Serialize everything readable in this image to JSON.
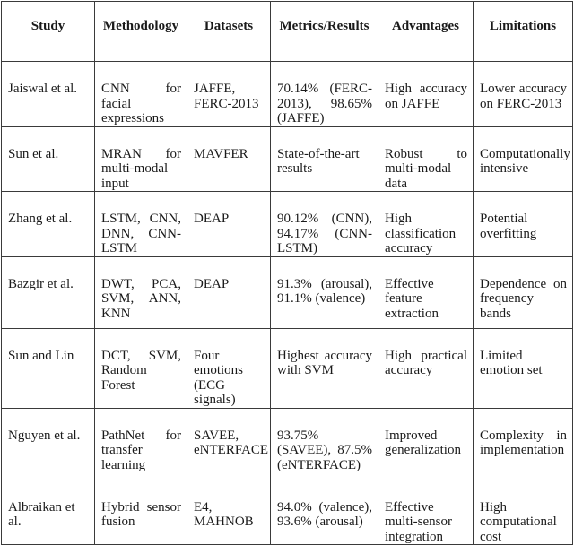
{
  "table": {
    "headers": [
      "Study",
      "Methodology",
      "Datasets",
      "Metrics/Results",
      "Advantages",
      "Limitations"
    ],
    "rows": [
      {
        "study": "Jaiswal et al.",
        "methodology": "CNN for facial expressions",
        "datasets": "JAFFE, FERC-2013",
        "metrics": "70.14% (FERC-2013), 98.65% (JAFFE)",
        "advantages": "High accuracy on JAFFE",
        "limitations": "Lower accuracy on FERC-2013"
      },
      {
        "study": "Sun et al.",
        "methodology": "MRAN for multi-modal input",
        "datasets": "MAVFER",
        "metrics": "State-of-the-art results",
        "advantages": "Robust to multi-modal data",
        "limitations": "Computationally intensive"
      },
      {
        "study": "Zhang et al.",
        "methodology": "LSTM, CNN, DNN, CNN-LSTM",
        "datasets": "DEAP",
        "metrics": "90.12% (CNN), 94.17% (CNN-LSTM)",
        "advantages": "High classification accuracy",
        "limitations": "Potential overfitting"
      },
      {
        "study": "Bazgir et al.",
        "methodology": "DWT, PCA, SVM, ANN, KNN",
        "datasets": "DEAP",
        "metrics": "91.3% (arousal), 91.1% (valence)",
        "advantages": "Effective feature extraction",
        "limitations": "Dependence on frequency bands"
      },
      {
        "study": "Sun and Lin",
        "methodology": "DCT, SVM, Random Forest",
        "datasets": "Four emotions (ECG signals)",
        "metrics": "Highest accuracy with SVM",
        "advantages": "High practical accuracy",
        "limitations": "Limited emotion set"
      },
      {
        "study": "Nguyen et al.",
        "methodology": "PathNet for transfer learning",
        "datasets": "SAVEE, eNTERFACE",
        "metrics": "93.75% (SAVEE), 87.5% (eNTERFACE)",
        "advantages": "Improved generalization",
        "limitations": "Complexity in implementation"
      },
      {
        "study": "Albraikan et al.",
        "methodology": "Hybrid sensor fusion",
        "datasets": "E4, MAHNOB",
        "metrics": "94.0% (valence), 93.6% (arousal)",
        "advantages": "Effective multi-sensor integration",
        "limitations": "High computational cost"
      }
    ]
  }
}
